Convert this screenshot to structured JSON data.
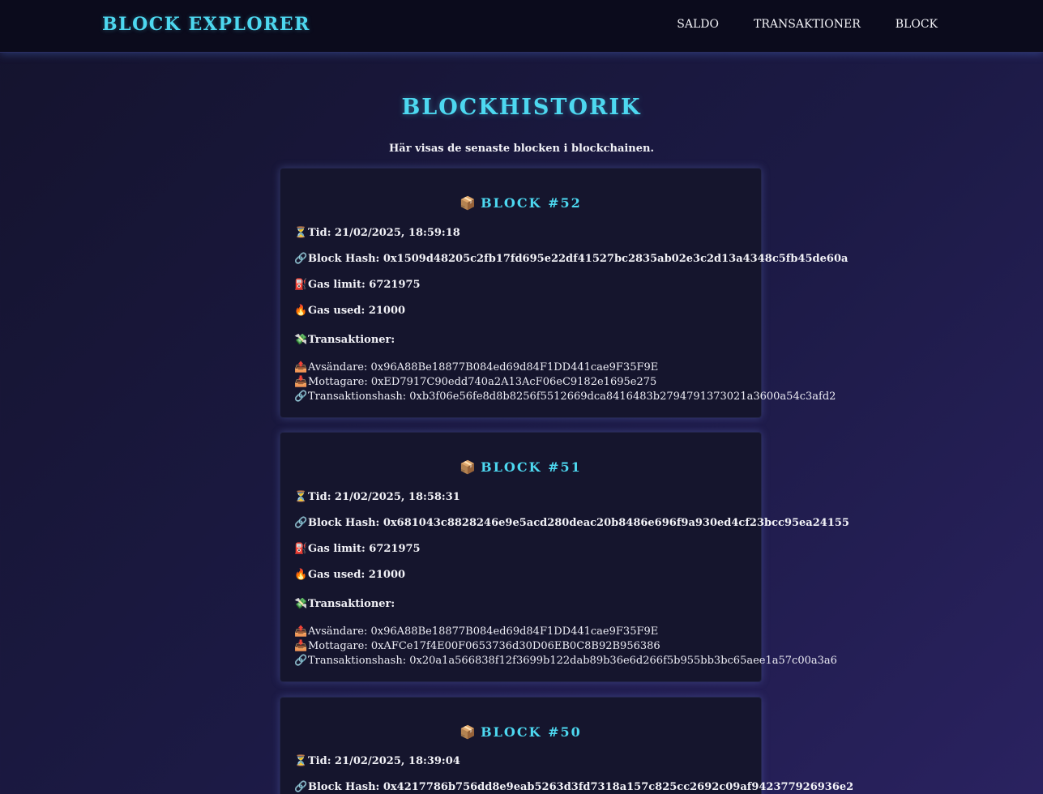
{
  "nav": {
    "brand": "BLOCK EXPLORER",
    "links": [
      "SALDO",
      "TRANSAKTIONER",
      "BLOCK"
    ]
  },
  "page": {
    "title": "BLOCKHISTORIK",
    "subtitle": "Här visas de senaste blocken i blockchainen."
  },
  "icons": {
    "block": "📦",
    "time": "⏳",
    "hash": "🔗",
    "gas_limit": "⛽",
    "gas_used": "🔥",
    "transactions": "💸",
    "sender": "📤",
    "receiver": "📥",
    "tx_hash": "🔗"
  },
  "blocks": [
    {
      "title": "BLOCK #52",
      "time": "Tid: 21/02/2025, 18:59:18",
      "hash": "Block Hash: 0x1509d48205c2fb17fd695e22df41527bc2835ab02e3c2d13a4348c5fb45de60a",
      "gas_limit": "Gas limit: 6721975",
      "gas_used": "Gas used: 21000",
      "transactions_label": "Transaktioner:",
      "sender": "Avsändare: 0x96A88Be18877B084ed69d84F1DD441cae9F35F9E",
      "receiver": "Mottagare: 0xED7917C90edd740a2A13AcF06eC9182e1695e275",
      "tx_hash": "Transaktionshash: 0xb3f06e56fe8d8b8256f5512669dca8416483b2794791373021a3600a54c3afd2"
    },
    {
      "title": "BLOCK #51",
      "time": "Tid: 21/02/2025, 18:58:31",
      "hash": "Block Hash: 0x681043c8828246e9e5acd280deac20b8486e696f9a930ed4cf23bcc95ea24155",
      "gas_limit": "Gas limit: 6721975",
      "gas_used": "Gas used: 21000",
      "transactions_label": "Transaktioner:",
      "sender": "Avsändare: 0x96A88Be18877B084ed69d84F1DD441cae9F35F9E",
      "receiver": "Mottagare: 0xAFCe17f4E00F0653736d30D06EB0C8B92B956386",
      "tx_hash": "Transaktionshash: 0x20a1a566838f12f3699b122dab89b36e6d266f5b955bb3bc65aee1a57c00a3a6"
    },
    {
      "title": "BLOCK #50",
      "time": "Tid: 21/02/2025, 18:39:04",
      "hash": "Block Hash: 0x4217786b756dd8e9eab5263d3fd7318a157c825cc2692c09af942377926936e2"
    }
  ]
}
